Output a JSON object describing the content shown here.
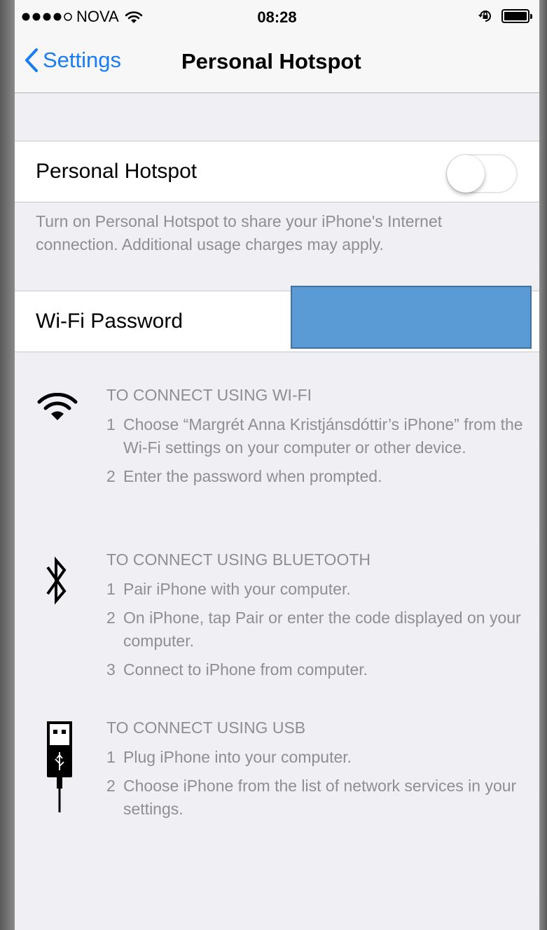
{
  "status_bar": {
    "carrier": "NOVA",
    "time": "08:28"
  },
  "nav": {
    "back_label": "Settings",
    "title": "Personal Hotspot"
  },
  "hotspot": {
    "label": "Personal Hotspot",
    "enabled": false,
    "footer": "Turn on Personal Hotspot to share your iPhone's Internet connection. Additional usage charges may apply."
  },
  "wifi_password": {
    "label": "Wi-Fi Password"
  },
  "instructions": {
    "wifi": {
      "title": "TO CONNECT USING WI-FI",
      "steps": [
        {
          "num": "1",
          "text": "Choose “Margrét Anna Kristjánsdóttir’s iPhone” from the Wi-Fi settings on your computer or other device."
        },
        {
          "num": "2",
          "text": "Enter the password when prompted."
        }
      ]
    },
    "bluetooth": {
      "title": "TO CONNECT USING BLUETOOTH",
      "steps": [
        {
          "num": "1",
          "text": "Pair iPhone with your computer."
        },
        {
          "num": "2",
          "text": "On iPhone, tap Pair or enter the code displayed on your computer."
        },
        {
          "num": "3",
          "text": "Connect to iPhone from computer."
        }
      ]
    },
    "usb": {
      "title": "TO CONNECT USING USB",
      "steps": [
        {
          "num": "1",
          "text": "Plug iPhone into your computer."
        },
        {
          "num": "2",
          "text": "Choose iPhone from the list of network services in your settings."
        }
      ]
    }
  },
  "colors": {
    "accent": "#1a7cf2",
    "secondary_text": "#8e8e93",
    "redaction": "#5b9bd5"
  },
  "icons": [
    "signal-dots-icon",
    "wifi-status-icon",
    "rotation-lock-icon",
    "battery-icon",
    "chevron-left-icon",
    "wifi-icon",
    "bluetooth-icon",
    "usb-icon"
  ]
}
